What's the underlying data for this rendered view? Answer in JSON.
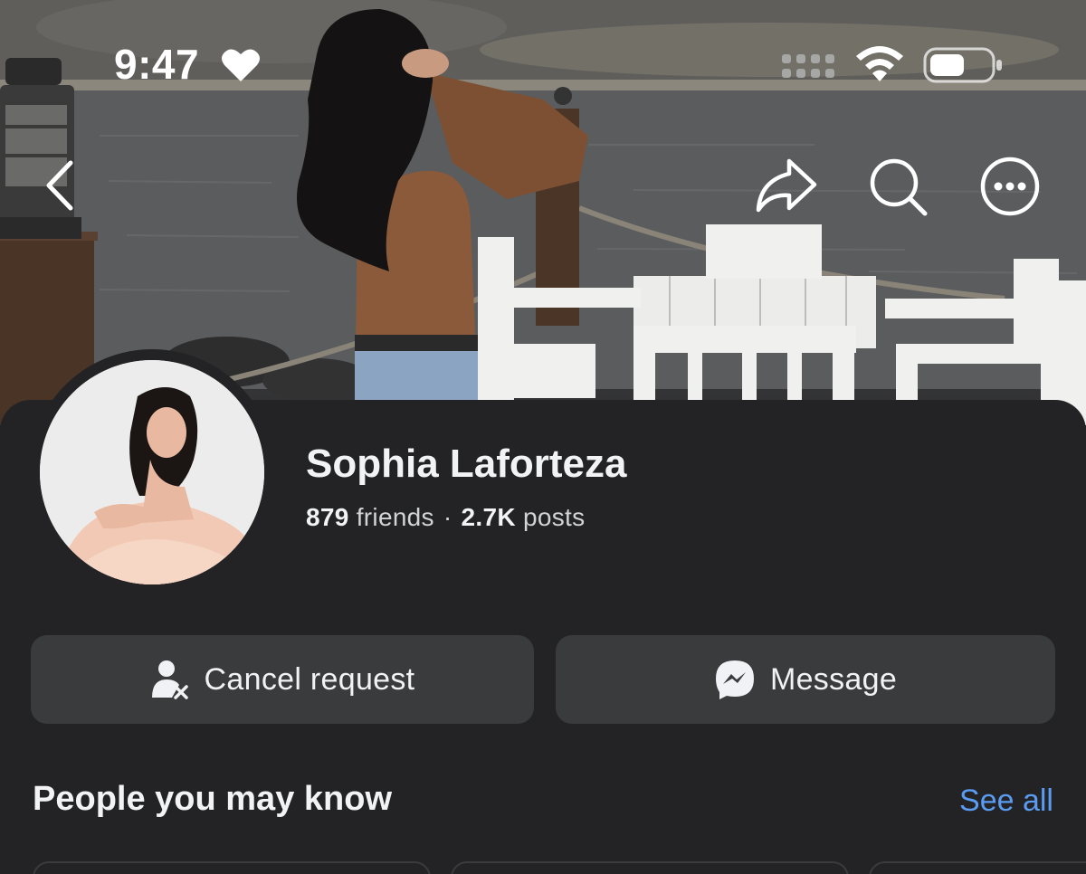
{
  "status_bar": {
    "time": "9:47",
    "time_icon": "heart-icon",
    "signal_icon": "cellular-signal-icon",
    "wifi_icon": "wifi-icon",
    "battery_icon": "battery-icon",
    "battery_level": 0.55
  },
  "nav": {
    "back_icon": "chevron-left-icon",
    "share_icon": "share-icon",
    "search_icon": "search-icon",
    "more_icon": "more-icon"
  },
  "profile": {
    "name": "Sophia Laforteza",
    "friends_count": "879",
    "friends_label": "friends",
    "separator": "·",
    "posts_count": "2.7K",
    "posts_label": "posts"
  },
  "actions": {
    "cancel_request_label": "Cancel request",
    "cancel_request_icon": "person-remove-icon",
    "message_label": "Message",
    "message_icon": "messenger-icon"
  },
  "people_you_may_know": {
    "title": "People you may know",
    "see_all_label": "See all"
  },
  "colors": {
    "background": "#232325",
    "button": "#3a3b3d",
    "link": "#5a9cf2",
    "text": "#f2f3f5"
  }
}
